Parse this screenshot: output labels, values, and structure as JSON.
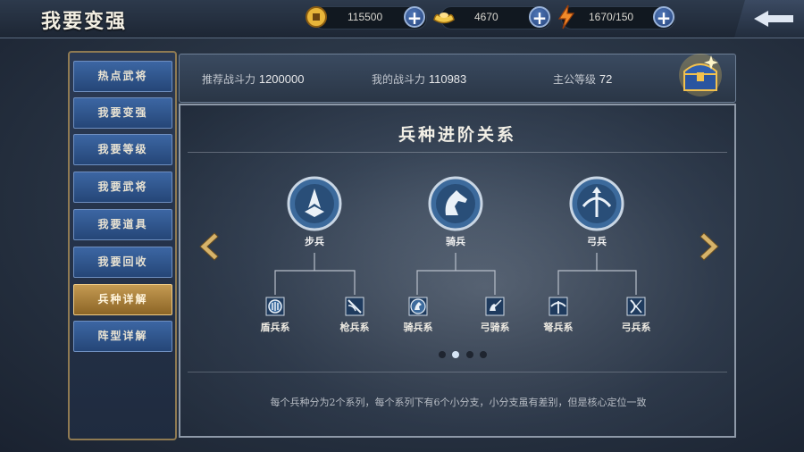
{
  "header": {
    "title": "我要变强"
  },
  "resources": [
    {
      "name": "copper",
      "icon": "coin-icon",
      "value": "115500"
    },
    {
      "name": "gold-ingot",
      "icon": "ingot-icon",
      "value": "4670"
    },
    {
      "name": "stamina",
      "icon": "lightning-icon",
      "value": "1670/150"
    }
  ],
  "sidebar": {
    "items": [
      {
        "label": "热点武将",
        "active": false
      },
      {
        "label": "我要变强",
        "active": false
      },
      {
        "label": "我要等级",
        "active": false
      },
      {
        "label": "我要武将",
        "active": false
      },
      {
        "label": "我要道具",
        "active": false
      },
      {
        "label": "我要回收",
        "active": false
      },
      {
        "label": "兵种详解",
        "active": true
      },
      {
        "label": "阵型详解",
        "active": false
      }
    ]
  },
  "stats": {
    "recommended_label": "推荐战斗力",
    "recommended_value": "1200000",
    "mine_label": "我的战斗力",
    "mine_value": "110983",
    "lord_level_label": "主公等级",
    "lord_level_value": "72"
  },
  "panel": {
    "title": "兵种进阶关系",
    "branches": [
      {
        "label": "步兵",
        "icon": "infantry-icon",
        "children": [
          {
            "label": "盾兵系",
            "icon": "shield-icon"
          },
          {
            "label": "枪兵系",
            "icon": "spear-icon"
          }
        ]
      },
      {
        "label": "骑兵",
        "icon": "horse-icon",
        "children": [
          {
            "label": "骑兵系",
            "icon": "cavalry-icon"
          },
          {
            "label": "弓骑系",
            "icon": "horse-archer-icon"
          }
        ]
      },
      {
        "label": "弓兵",
        "icon": "bow-icon",
        "children": [
          {
            "label": "弩兵系",
            "icon": "crossbow-icon"
          },
          {
            "label": "弓兵系",
            "icon": "archer-icon"
          }
        ]
      }
    ],
    "pagination": {
      "pages": 4,
      "current": 2
    },
    "description": "每个兵种分为2个系列，每个系列下有6个小分支，小分支虽有差别，但是核心定位一致"
  },
  "colors": {
    "active_tab": "#c49a52",
    "tab": "#3c66a3",
    "accent_blue": "#4f76b6"
  }
}
